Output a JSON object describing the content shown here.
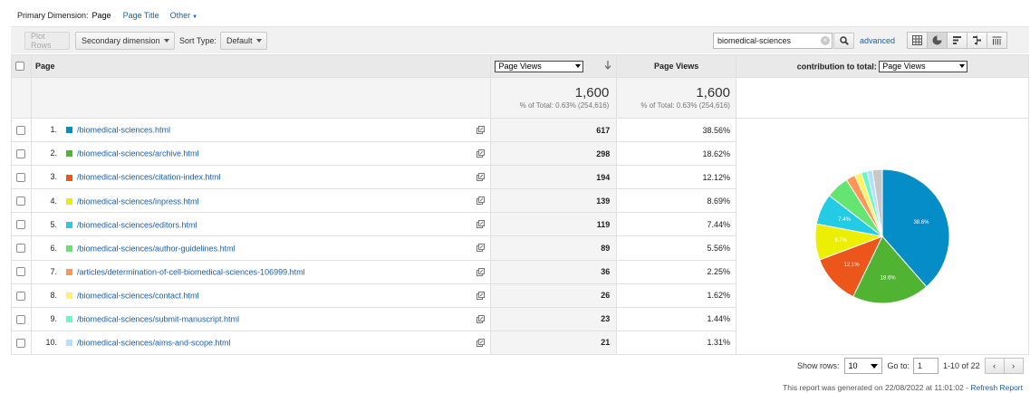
{
  "primary_dimension": {
    "label": "Primary Dimension:",
    "active": "Page",
    "options": [
      "Page Title",
      "Other"
    ]
  },
  "toolbar": {
    "plot_rows": "Plot Rows",
    "secondary_dimension": "Secondary dimension",
    "sort_type_label": "Sort Type:",
    "sort_type_value": "Default",
    "search_value": "biomedical-sciences",
    "advanced": "advanced",
    "view_icons": [
      "table-view-icon",
      "pie-view-icon",
      "performance-view-icon",
      "comparison-view-icon",
      "pivot-view-icon"
    ]
  },
  "table": {
    "col_page": "Page",
    "metric_select": "Page Views",
    "col_pageviews": "Page Views",
    "contribution_label": "contribution to total:",
    "contribution_select": "Page Views",
    "totals": {
      "pv_value": "1,600",
      "pv_sub": "% of Total: 0.63% (254,616)",
      "pct_value": "1,600",
      "pct_sub": "% of Total: 0.63% (254,616)"
    },
    "rows": [
      {
        "num": "1.",
        "page": "/biomedical-sciences.html",
        "views": "617",
        "pct": "38.56%",
        "color": "#058dc7"
      },
      {
        "num": "2.",
        "page": "/biomedical-sciences/archive.html",
        "views": "298",
        "pct": "18.62%",
        "color": "#50b432"
      },
      {
        "num": "3.",
        "page": "/biomedical-sciences/citation-index.html",
        "views": "194",
        "pct": "12.12%",
        "color": "#ed561b"
      },
      {
        "num": "4.",
        "page": "/biomedical-sciences/inpress.html",
        "views": "139",
        "pct": "8.69%",
        "color": "#edef00"
      },
      {
        "num": "5.",
        "page": "/biomedical-sciences/editors.html",
        "views": "119",
        "pct": "7.44%",
        "color": "#24cbe5"
      },
      {
        "num": "6.",
        "page": "/biomedical-sciences/author-guidelines.html",
        "views": "89",
        "pct": "5.56%",
        "color": "#64e572"
      },
      {
        "num": "7.",
        "page": "/articles/determination-of-cell-biomedical-sciences-106999.html",
        "views": "36",
        "pct": "2.25%",
        "color": "#ff9655"
      },
      {
        "num": "8.",
        "page": "/biomedical-sciences/contact.html",
        "views": "26",
        "pct": "1.62%",
        "color": "#fff263"
      },
      {
        "num": "9.",
        "page": "/biomedical-sciences/submit-manuscript.html",
        "views": "23",
        "pct": "1.44%",
        "color": "#6af9c4"
      },
      {
        "num": "10.",
        "page": "/biomedical-sciences/aims-and-scope.html",
        "views": "21",
        "pct": "1.31%",
        "color": "#b2deff"
      }
    ]
  },
  "chart_data": {
    "type": "pie",
    "categories": [
      "/biomedical-sciences.html",
      "/biomedical-sciences/archive.html",
      "/biomedical-sciences/citation-index.html",
      "/biomedical-sciences/inpress.html",
      "/biomedical-sciences/editors.html",
      "/biomedical-sciences/author-guidelines.html",
      "/articles/determination-of-cell-biomedical-sciences-106999.html",
      "/biomedical-sciences/contact.html",
      "/biomedical-sciences/submit-manuscript.html",
      "/biomedical-sciences/aims-and-scope.html",
      "(other)"
    ],
    "values": [
      38.56,
      18.62,
      12.12,
      8.69,
      7.44,
      5.56,
      2.25,
      1.62,
      1.44,
      1.31,
      2.39
    ],
    "colors": [
      "#058dc7",
      "#50b432",
      "#ed561b",
      "#edef00",
      "#24cbe5",
      "#64e572",
      "#ff9655",
      "#fff263",
      "#6af9c4",
      "#b2deff",
      "#c8c8c8"
    ],
    "slice_labels": [
      "38.6%",
      "18.6%",
      "12.1%",
      "8.7%",
      "7.4%",
      "",
      "",
      "",
      "",
      "",
      ""
    ]
  },
  "pager": {
    "show_rows_label": "Show rows:",
    "show_rows_value": "10",
    "goto_label": "Go to:",
    "goto_value": "1",
    "range": "1-10 of 22",
    "prev": "‹",
    "next": "›"
  },
  "footer": {
    "generated_text": "This report was generated on 22/08/2022 at 11:01:02 - ",
    "refresh": "Refresh Report"
  }
}
